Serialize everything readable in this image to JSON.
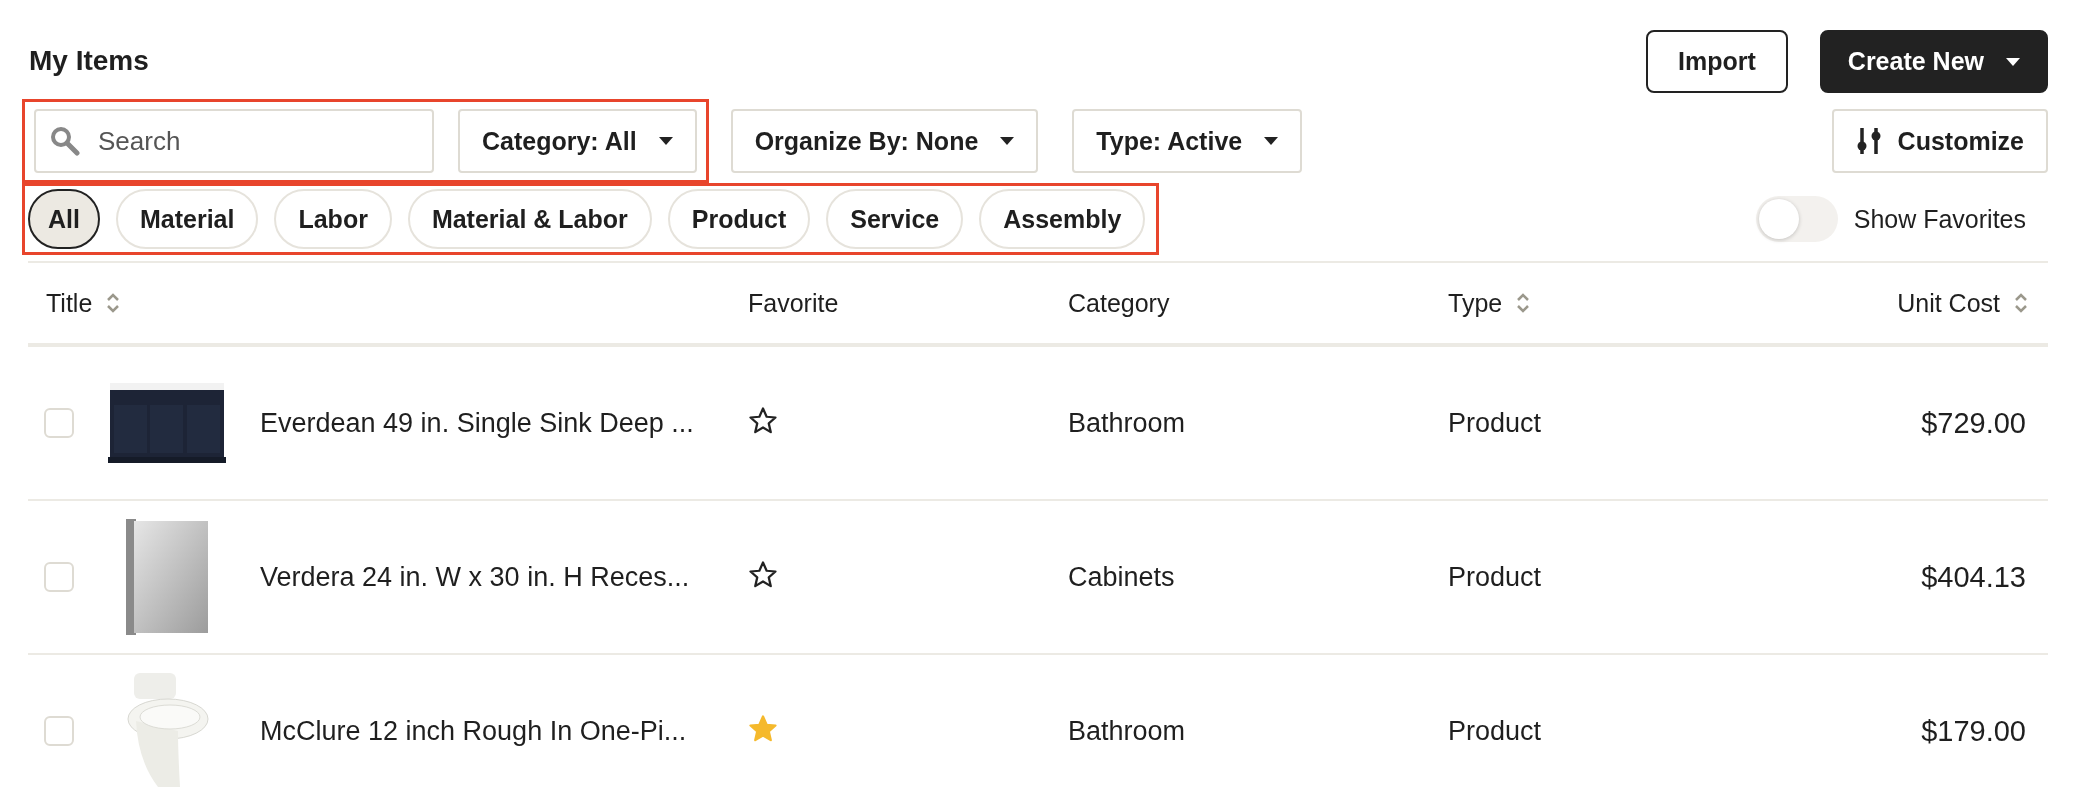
{
  "page_title": "My Items",
  "actions": [
    {
      "kind": "outline",
      "label": "Import"
    },
    {
      "kind": "primary",
      "label": "Create New"
    }
  ],
  "filter_bar": {
    "highlighted": true,
    "search": {
      "placeholder": "Search"
    },
    "category": {
      "label": "Category: All"
    }
  },
  "dropdowns": [
    {
      "label": "Organize By: None"
    },
    {
      "label": "Type: Active"
    }
  ],
  "customize": {
    "label": "Customize"
  },
  "chip_bar": {
    "highlighted": true,
    "chips": [
      {
        "label": "All",
        "selected": true
      },
      {
        "label": "Material",
        "selected": false
      },
      {
        "label": "Labor",
        "selected": false
      },
      {
        "label": "Material & Labor",
        "selected": false
      },
      {
        "label": "Product",
        "selected": false
      },
      {
        "label": "Service",
        "selected": false
      },
      {
        "label": "Assembly",
        "selected": false
      }
    ]
  },
  "show_favorites": {
    "label": "Show Favorites",
    "on": false
  },
  "table": {
    "columns": [
      {
        "label": "Title",
        "sortable": true
      },
      {
        "label": "Favorite",
        "sortable": false
      },
      {
        "label": "Category",
        "sortable": false
      },
      {
        "label": "Type",
        "sortable": true
      },
      {
        "label": "Unit Cost",
        "sortable": true
      }
    ],
    "rows": [
      {
        "checked": false,
        "title": "Everdean 49 in. Single Sink Deep ...",
        "favorite": false,
        "category": "Bathroom",
        "type": "Product",
        "unit_cost": "$729.00"
      },
      {
        "checked": false,
        "title": "Verdera 24 in. W x 30 in. H Reces...",
        "favorite": false,
        "category": "Cabinets",
        "type": "Product",
        "unit_cost": "$404.13"
      },
      {
        "checked": false,
        "title": "McClure 12 inch Rough In One-Pi...",
        "favorite": true,
        "category": "Bathroom",
        "type": "Product",
        "unit_cost": "$179.00"
      }
    ]
  }
}
